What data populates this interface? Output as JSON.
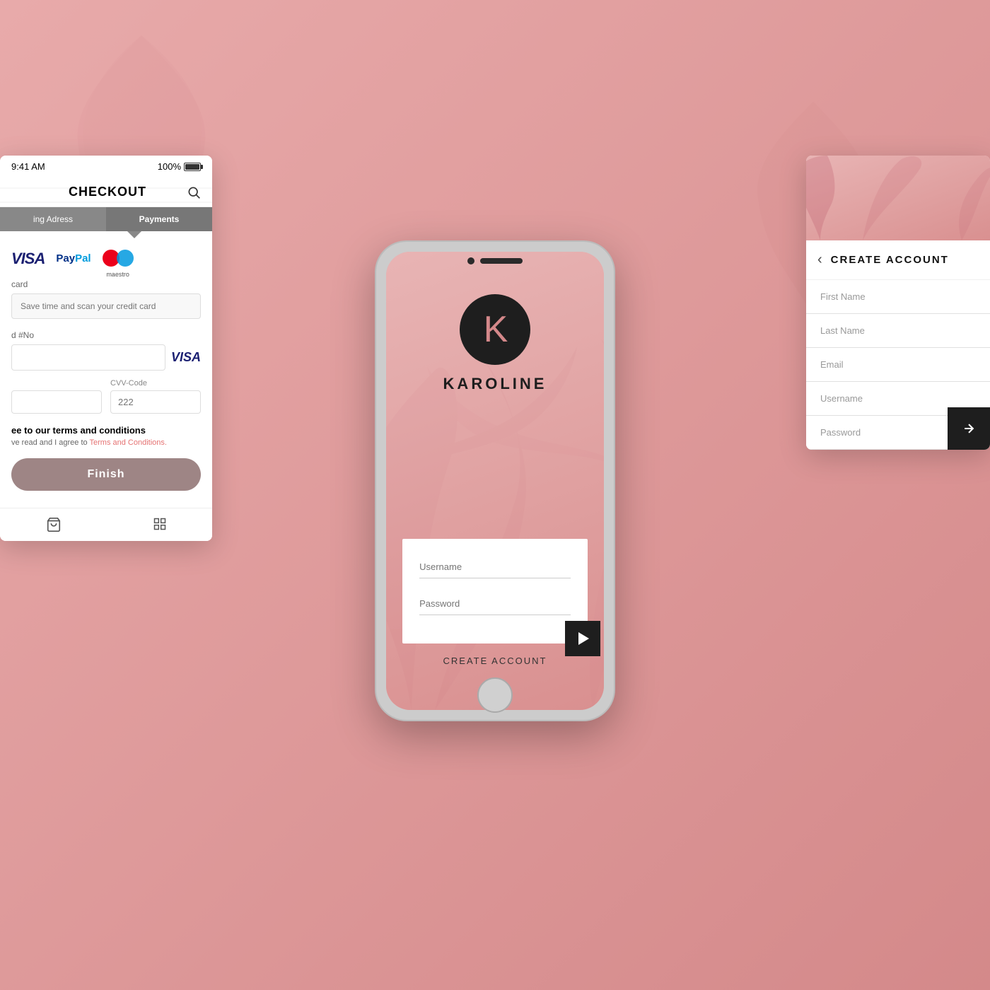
{
  "background": {
    "color": "#e8a0a0"
  },
  "left_phone": {
    "status_bar": {
      "time": "9:41 AM",
      "battery": "100%"
    },
    "header": {
      "title": "CHECKOUT",
      "search_icon": "search"
    },
    "tabs": [
      {
        "label": "ing Adress",
        "active": false
      },
      {
        "label": "Payments",
        "active": true
      }
    ],
    "payment_methods": {
      "visa_label": "VISA",
      "paypal_label": "PayPal",
      "maestro_label": "maestro"
    },
    "form": {
      "scan_label": "card",
      "scan_placeholder": "Save time and scan your credit card",
      "card_number_label": "d #No",
      "cvv_label": "CVV-Code",
      "cvv_placeholder": "222"
    },
    "terms": {
      "title": "ee to our terms and conditions",
      "text": "ve read and I agree to",
      "link_text": "Terms and Conditions."
    },
    "finish_button": "Finish",
    "nav": {
      "cart_icon": "cart",
      "grid_icon": "grid"
    }
  },
  "center_phone": {
    "logo": {
      "letter": "K",
      "name": "KAROLINE"
    },
    "form": {
      "username_placeholder": "Username",
      "password_placeholder": "Password"
    },
    "create_account_link": "CREATE ACCOUNT",
    "play_button": "▶"
  },
  "right_phone": {
    "header": {
      "back_icon": "‹",
      "title": "CREATE ACCOU"
    },
    "form": {
      "fields": [
        {
          "placeholder": "First Name"
        },
        {
          "placeholder": "Last Name"
        },
        {
          "placeholder": "Email"
        },
        {
          "placeholder": "Username"
        },
        {
          "placeholder": "Password"
        }
      ]
    }
  }
}
